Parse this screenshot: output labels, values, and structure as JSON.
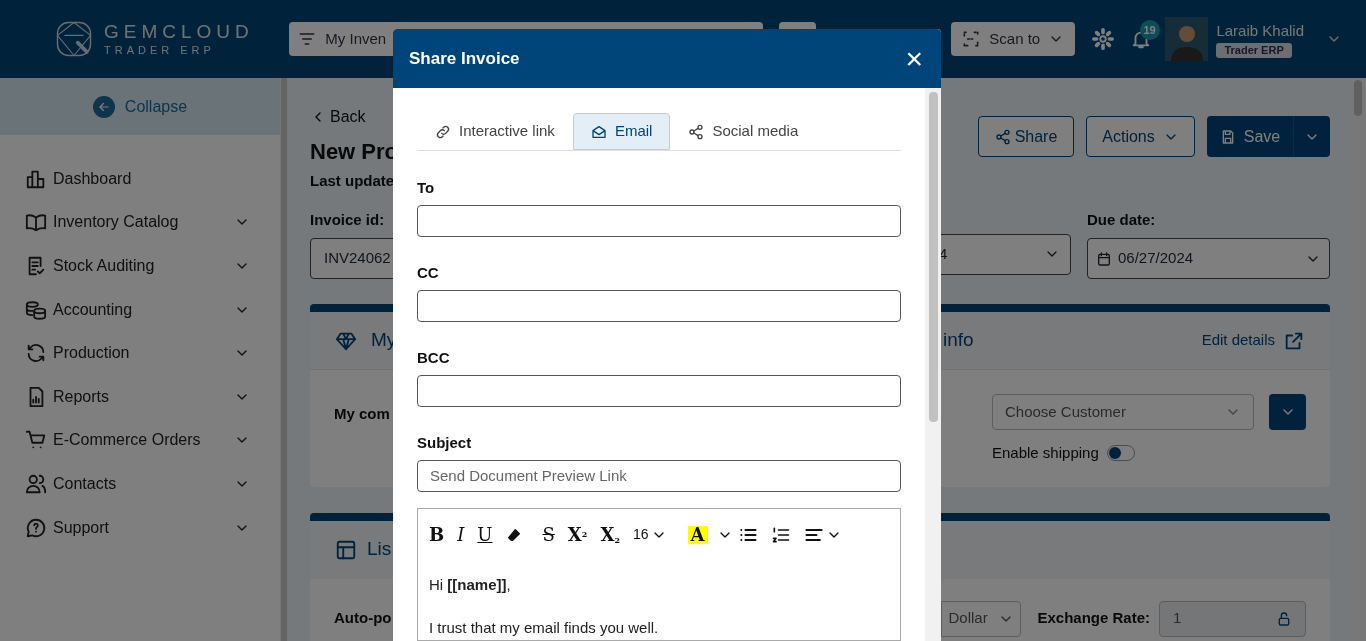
{
  "header": {
    "logo": {
      "name": "GEMCLOUD",
      "tagline": "TRADER ERP"
    },
    "filter_field": {
      "value": "My Inven"
    },
    "scan_button": "Scan to",
    "notification_count": "19",
    "user": {
      "name": "Laraib Khalid",
      "role": "Trader ERP"
    }
  },
  "sidebar": {
    "collapse_label": "Collapse",
    "items": [
      {
        "label": "Dashboard",
        "expandable": false
      },
      {
        "label": "Inventory Catalog",
        "expandable": true
      },
      {
        "label": "Stock Auditing",
        "expandable": true
      },
      {
        "label": "Accounting",
        "expandable": true
      },
      {
        "label": "Production",
        "expandable": true
      },
      {
        "label": "Reports",
        "expandable": true
      },
      {
        "label": "E-Commerce Orders",
        "expandable": true
      },
      {
        "label": "Contacts",
        "expandable": true
      },
      {
        "label": "Support",
        "expandable": true
      }
    ]
  },
  "page": {
    "back": "Back",
    "title": "New Pro",
    "last_updated": "Last update",
    "buttons": {
      "share": "Share",
      "actions": "Actions",
      "save": "Save"
    },
    "invoice_id_label": "Invoice id:",
    "invoice_id": "INV24062",
    "date_value": "4",
    "due_date_label": "Due date:",
    "due_date": "06/27/2024",
    "company_card": {
      "title_start": "My",
      "title_end": "info",
      "edit_details": "Edit details",
      "company_label": "My com",
      "customer_placeholder": "Choose Customer",
      "shipping_label": "Enable shipping",
      "shipping_on": false
    },
    "list_card": {
      "title": "Lis",
      "autopost_label": "Auto-po",
      "currency": "Dollar",
      "exchange_label": "Exchange Rate:",
      "exchange_rate": "1"
    }
  },
  "modal": {
    "title": "Share Invoice",
    "close": "×",
    "tabs": [
      {
        "label": "Interactive link",
        "selected": false
      },
      {
        "label": "Email",
        "selected": true
      },
      {
        "label": "Social media",
        "selected": false
      }
    ],
    "fields": [
      {
        "label": "To"
      },
      {
        "label": "CC"
      },
      {
        "label": "BCC"
      },
      {
        "label": "Subject",
        "placeholder": "Send Document Preview Link"
      }
    ],
    "toolbar": [
      {
        "kind": "bold",
        "label": "B"
      },
      {
        "kind": "italic",
        "label": "I"
      },
      {
        "kind": "underline",
        "label": "U"
      },
      {
        "kind": "eraser"
      },
      {
        "kind": "strike",
        "label": "S"
      },
      {
        "kind": "sup",
        "label": "X$^{2}$"
      },
      {
        "kind": "sub",
        "label": "X$_{2}$"
      },
      {
        "kind": "size",
        "label": "16"
      },
      {
        "kind": "highlight",
        "label": "A"
      },
      {
        "kind": "bullets"
      },
      {
        "kind": "numbers"
      },
      {
        "kind": "align"
      }
    ],
    "body": [
      "Hi **[[name]]**,",
      "I trust that my email finds you well."
    ]
  }
}
